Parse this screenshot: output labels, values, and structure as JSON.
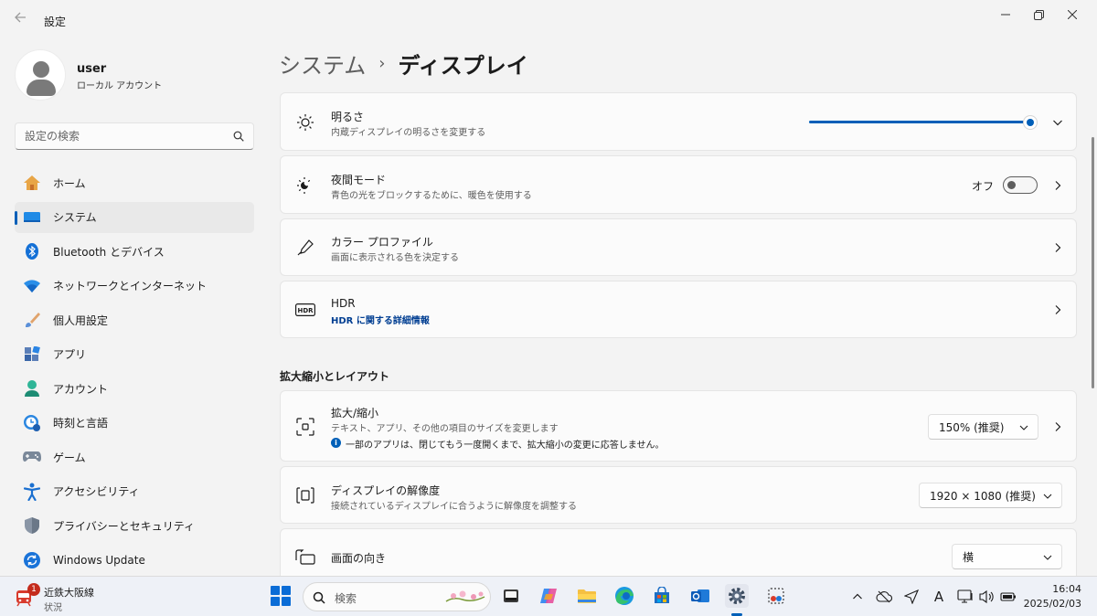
{
  "window": {
    "title": "設定",
    "back_icon": "back-arrow-icon",
    "controls": [
      "minimize-icon",
      "restore-icon",
      "close-icon"
    ]
  },
  "profile": {
    "name": "user",
    "account_type": "ローカル アカウント"
  },
  "search": {
    "placeholder": "設定の検索"
  },
  "sidebar": {
    "items": [
      {
        "label": "ホーム",
        "icon": "home-icon"
      },
      {
        "label": "システム",
        "icon": "system-icon",
        "active": true
      },
      {
        "label": "Bluetooth とデバイス",
        "icon": "bluetooth-icon"
      },
      {
        "label": "ネットワークとインターネット",
        "icon": "network-icon"
      },
      {
        "label": "個人用設定",
        "icon": "brush-icon"
      },
      {
        "label": "アプリ",
        "icon": "apps-icon"
      },
      {
        "label": "アカウント",
        "icon": "account-icon"
      },
      {
        "label": "時刻と言語",
        "icon": "time-language-icon"
      },
      {
        "label": "ゲーム",
        "icon": "gamepad-icon"
      },
      {
        "label": "アクセシビリティ",
        "icon": "accessibility-icon"
      },
      {
        "label": "プライバシーとセキュリティ",
        "icon": "shield-icon"
      },
      {
        "label": "Windows Update",
        "icon": "windows-update-icon"
      }
    ]
  },
  "breadcrumb": {
    "parent": "システム",
    "separator": "›",
    "current": "ディスプレイ"
  },
  "settings": {
    "brightness": {
      "title": "明るさ",
      "subtitle": "内蔵ディスプレイの明るさを変更する",
      "value_percent": 100,
      "icon": "sun-icon"
    },
    "night_light": {
      "title": "夜間モード",
      "subtitle": "青色の光をブロックするために、暖色を使用する",
      "state_label": "オフ",
      "icon": "night-light-icon"
    },
    "color_profile": {
      "title": "カラー プロファイル",
      "subtitle": "画面に表示される色を決定する",
      "icon": "color-picker-icon"
    },
    "hdr": {
      "title": "HDR",
      "link": "HDR に関する詳細情報",
      "icon": "hdr-icon"
    }
  },
  "scale_layout": {
    "section_title": "拡大縮小とレイアウト",
    "scale": {
      "title": "拡大/縮小",
      "subtitle": "テキスト、アプリ、その他の項目のサイズを変更します",
      "info": "一部のアプリは、閉じてもう一度開くまで、拡大縮小の変更に応答しません。",
      "value": "150% (推奨)",
      "icon": "scale-icon"
    },
    "resolution": {
      "title": "ディスプレイの解像度",
      "subtitle": "接続されているディスプレイに合うように解像度を調整する",
      "value": "1920 × 1080 (推奨)",
      "icon": "resolution-icon"
    },
    "orientation": {
      "title": "画面の向き",
      "value": "横",
      "icon": "orientation-icon"
    }
  },
  "taskbar": {
    "weather": {
      "title": "近鉄大阪線",
      "subtitle": "状況",
      "badge": "1"
    },
    "search_label": "検索",
    "apps": [
      "file-manager-icon",
      "copilot-icon",
      "explorer-folder-icon",
      "edge-icon",
      "store-icon",
      "outlook-icon",
      "settings-gear-icon",
      "snipping-tool-icon"
    ],
    "tray": [
      "chevron-up-icon",
      "cloud-off-icon",
      "location-icon",
      "ime-a-icon",
      "display-icon",
      "volume-icon",
      "battery-icon"
    ],
    "ime_label": "A",
    "time": "16:04",
    "date": "2025/02/03"
  },
  "colors": {
    "accent": "#005fb8",
    "background": "#f3f3f3",
    "card": "#fbfbfb"
  }
}
